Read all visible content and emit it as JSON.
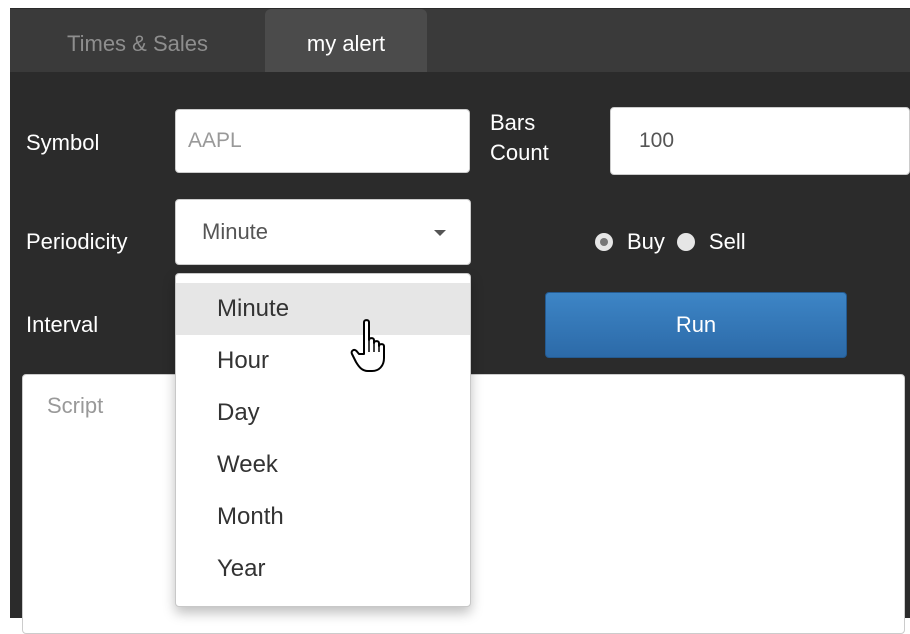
{
  "tabs": [
    {
      "label": "Times & Sales",
      "active": false
    },
    {
      "label": "my alert",
      "active": true
    }
  ],
  "form": {
    "symbol_label": "Symbol",
    "symbol_value": "AAPL",
    "bars_label_line1": "Bars",
    "bars_label_line2": "Count",
    "bars_value": "100",
    "periodicity_label": "Periodicity",
    "periodicity_value": "Minute",
    "interval_label": "Interval",
    "radio": {
      "buy_label": "Buy",
      "sell_label": "Sell",
      "selected": "Buy"
    },
    "run_label": "Run",
    "script_placeholder": "Script"
  },
  "dropdown": {
    "options": [
      "Minute",
      "Hour",
      "Day",
      "Week",
      "Month",
      "Year"
    ],
    "highlighted": "Minute"
  },
  "colors": {
    "panel_bg": "#2b2b2b",
    "tab_bar_bg": "#3a3a3a",
    "active_tab_bg": "#4b4b4b",
    "run_button": "#337ab7",
    "dropdown_highlight": "#e6e6e6"
  },
  "icons": {
    "select_caret": "caret-down-icon",
    "pointer": "hand-pointer-icon"
  }
}
